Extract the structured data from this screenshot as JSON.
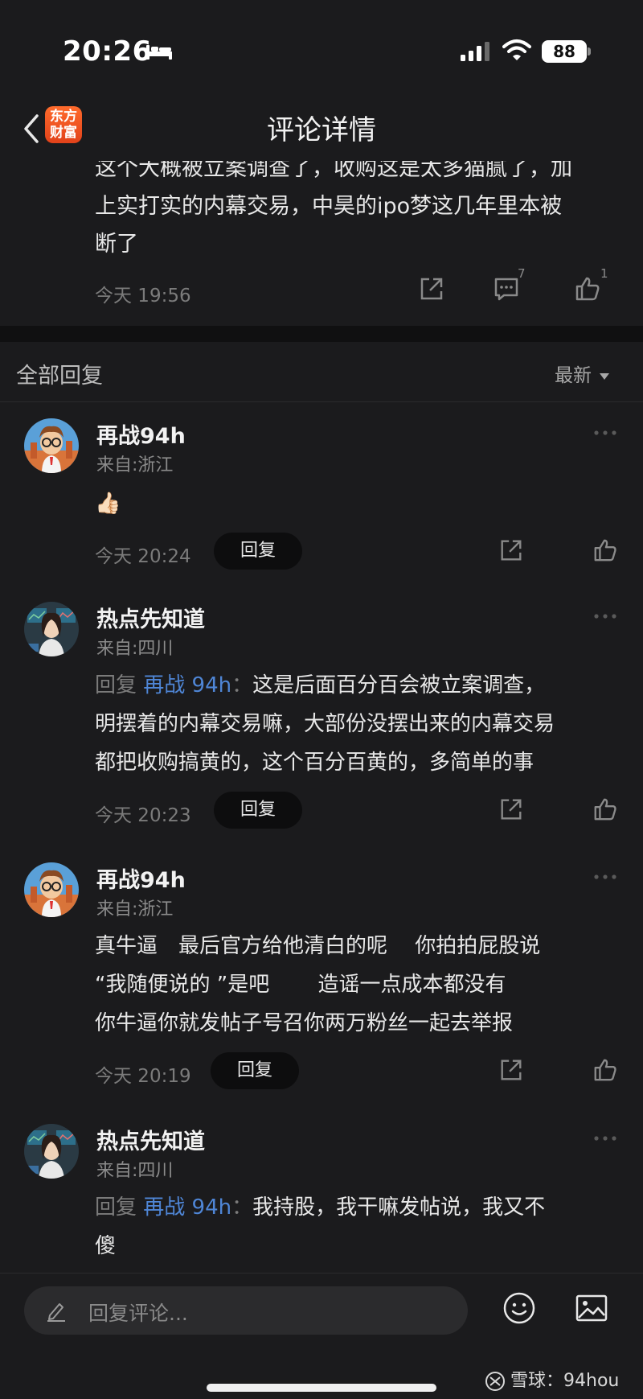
{
  "status_bar": {
    "time": "20:26",
    "battery": "88"
  },
  "nav": {
    "title": "评论详情",
    "logo_line1": "东方",
    "logo_line2": "财富"
  },
  "original_comment": {
    "text_lines": [
      "这个大概被立案调查了，收购这是太多猫腻了，加",
      "上实打实的内幕交易，中昊的ipo梦这几年里本被",
      "断了"
    ],
    "time": "今天 19:56",
    "comment_count": "7",
    "like_count": "1"
  },
  "replies_header": {
    "title": "全部回复",
    "sort": "最新"
  },
  "replies": [
    {
      "user": "再战94h",
      "location": "来自:浙江",
      "content": "👍🏻",
      "time": "今天 20:24",
      "reply_label": "回复"
    },
    {
      "user": "热点先知道",
      "location": "来自:四川",
      "prefix": "回复",
      "target": "再战 94h",
      "colon": "：",
      "content_lines": [
        "这是后面百分百会被立案调查，",
        "明摆着的内幕交易嘛，大部份没摆出来的内幕交易",
        "都把收购搞黄的，这个百分百黄的，多简单的事"
      ],
      "time": "今天 20:23",
      "reply_label": "回复"
    },
    {
      "user": "再战94h",
      "location": "来自:浙江",
      "content_lines": [
        "真牛逼　最后官方给他清白的呢　 你拍拍屁股说",
        "“我随便说的 ”是吧　　 造谣一点成本都没有",
        "你牛逼你就发帖子号召你两万粉丝一起去举报"
      ],
      "time": "今天 20:19",
      "reply_label": "回复"
    },
    {
      "user": "热点先知道",
      "location": "来自:四川",
      "prefix": "回复",
      "target": "再战 94h",
      "colon": "：",
      "content_lines": [
        "我持股，我干嘛发帖说，我又不",
        "傻"
      ]
    }
  ],
  "bottom_bar": {
    "placeholder": "回复评论...",
    "watermark": "雪球：94hou"
  },
  "colors": {
    "background": "#1b1b1d",
    "link_blue": "#4f86d6",
    "logo_orange": "#ff6b2c"
  }
}
